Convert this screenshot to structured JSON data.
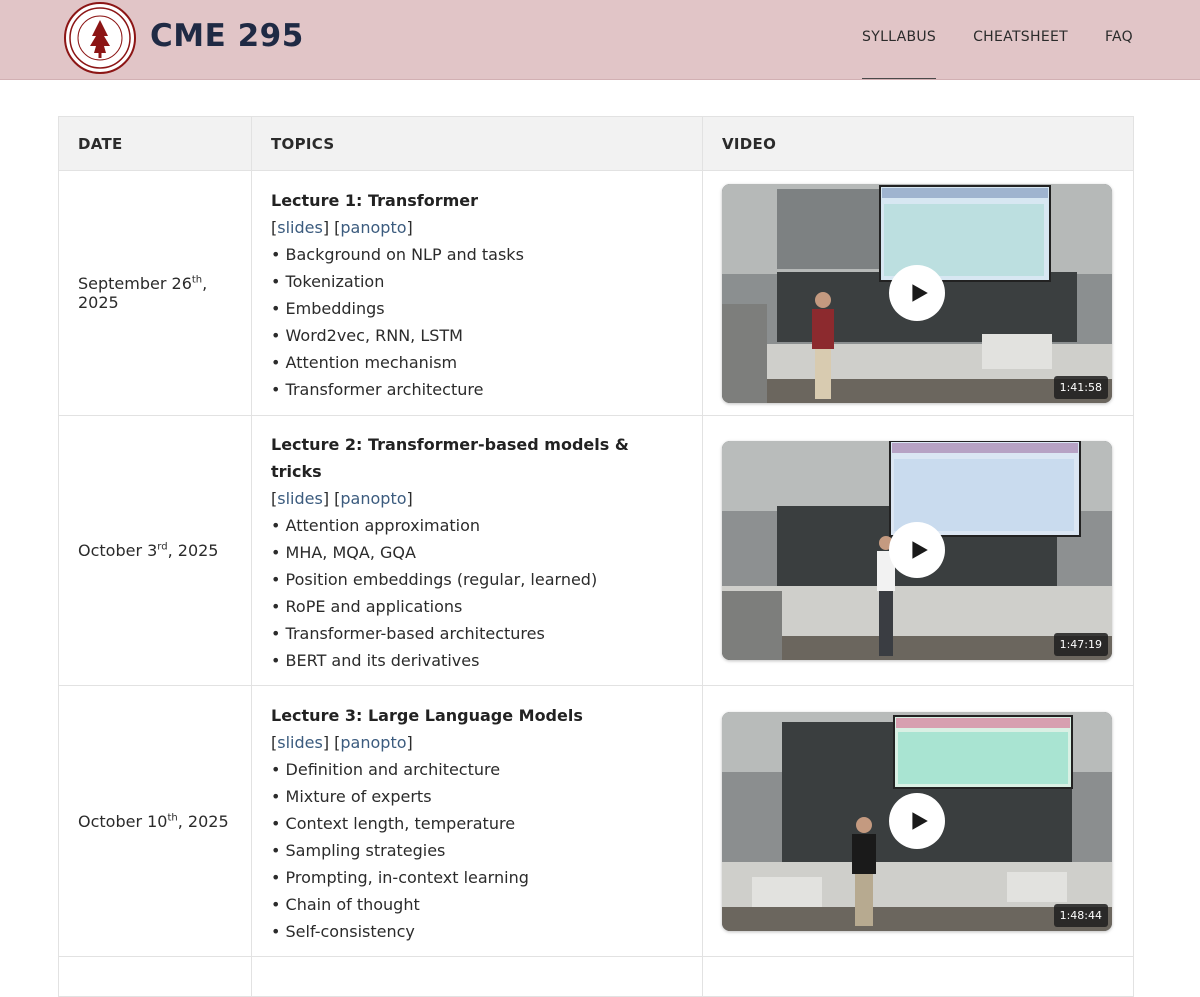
{
  "header": {
    "brand": "CME 295",
    "logo_icon": "stanford-seal-icon",
    "nav": [
      {
        "label": "SYLLABUS",
        "active": true
      },
      {
        "label": "CHEATSHEET",
        "active": false
      },
      {
        "label": "FAQ",
        "active": false
      }
    ]
  },
  "table": {
    "columns": [
      "DATE",
      "TOPICS",
      "VIDEO"
    ],
    "rows": [
      {
        "date_main": "September 26",
        "date_sup": "th",
        "date_year": ", 2025",
        "title": "Lecture 1: Transformer",
        "link_slides": "slides",
        "link_panopto": "panopto",
        "topics": [
          "• Background on NLP and tasks",
          "• Tokenization",
          "• Embeddings",
          "• Word2vec, RNN, LSTM",
          "• Attention mechanism",
          "• Transformer architecture"
        ],
        "duration": "1:41:58"
      },
      {
        "date_main": "October 3",
        "date_sup": "rd",
        "date_year": ", 2025",
        "title": "Lecture 2: Transformer-based models & tricks",
        "link_slides": "slides",
        "link_panopto": "panopto",
        "topics": [
          "• Attention approximation",
          "• MHA, MQA, GQA",
          "• Position embeddings (regular, learned)",
          "• RoPE and applications",
          "• Transformer-based architectures",
          "• BERT and its derivatives"
        ],
        "duration": "1:47:19"
      },
      {
        "date_main": "October 10",
        "date_sup": "th",
        "date_year": ", 2025",
        "title": "Lecture 3: Large Language Models",
        "link_slides": "slides",
        "link_panopto": "panopto",
        "topics": [
          "• Definition and architecture",
          "• Mixture of experts",
          "• Context length, temperature",
          "• Sampling strategies",
          "• Prompting, in-context learning",
          "• Chain of thought",
          "• Self-consistency"
        ],
        "duration": "1:48:44"
      }
    ]
  },
  "colors": {
    "header_bg": "#e1c5c7",
    "brand_text": "#1f2a44",
    "link": "#3b5b7e",
    "stanford_red": "#8c1515"
  }
}
